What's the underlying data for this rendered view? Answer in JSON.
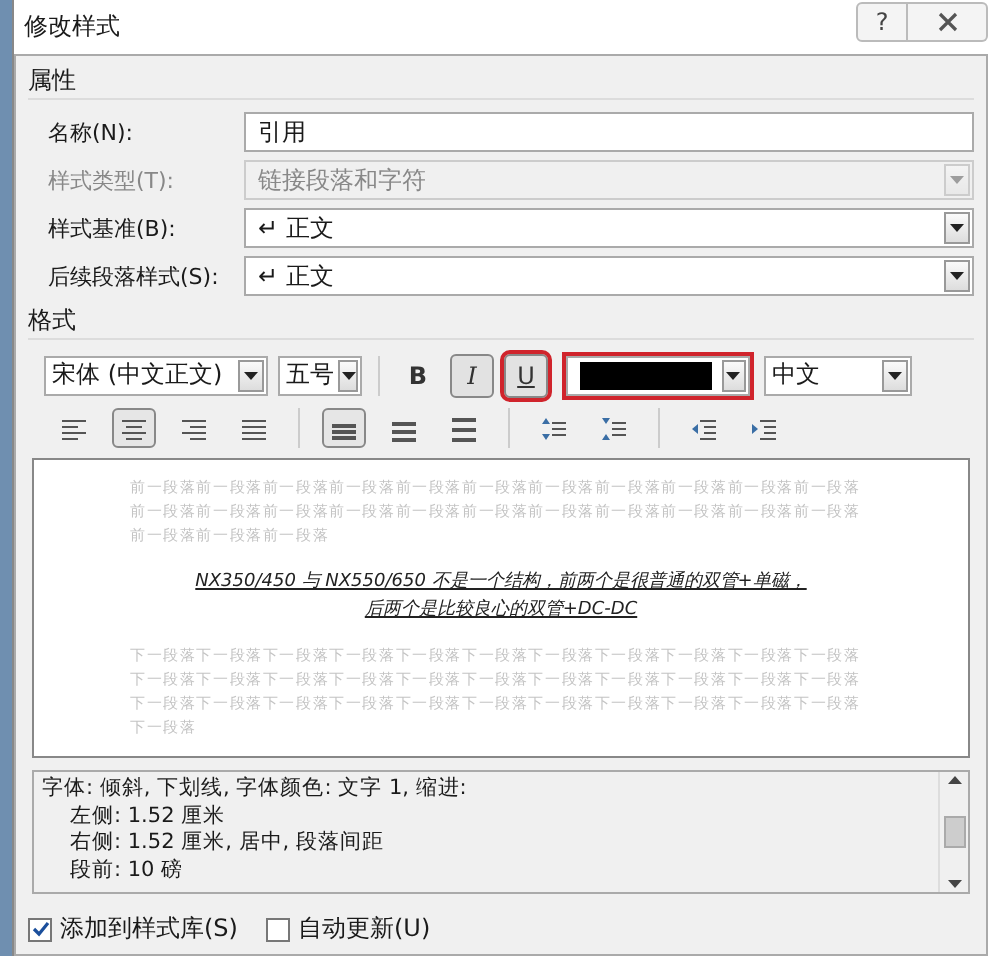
{
  "window": {
    "title": "修改样式",
    "help_button": "?"
  },
  "properties": {
    "heading": "属性",
    "rows": [
      {
        "label": "名称(N):",
        "kind": "text",
        "value": "引用",
        "disabled": false
      },
      {
        "label": "样式类型(T):",
        "kind": "select",
        "value": "链接段落和字符",
        "disabled": true
      },
      {
        "label": "样式基准(B):",
        "kind": "select",
        "value": "↵ 正文",
        "disabled": false
      },
      {
        "label": "后续段落样式(S):",
        "kind": "select",
        "value": "↵ 正文",
        "disabled": false
      }
    ]
  },
  "format": {
    "heading": "格式",
    "font_select": {
      "value": "宋体 (中文正文)"
    },
    "size_select": {
      "value": "五号"
    },
    "style_buttons": [
      {
        "label": "B",
        "kind": "bold",
        "selected": false,
        "highlighted": false
      },
      {
        "label": "I",
        "kind": "italic",
        "selected": true,
        "highlighted": false
      },
      {
        "label": "U",
        "kind": "underline",
        "selected": true,
        "highlighted": true
      }
    ],
    "color_select": {
      "color": "#000000",
      "highlighted": true
    },
    "language_select": {
      "value": "中文"
    },
    "paragraph_toolbar": [
      [
        {
          "kind": "align-left",
          "selected": false
        },
        {
          "kind": "align-center",
          "selected": true
        },
        {
          "kind": "align-right",
          "selected": false
        },
        {
          "kind": "justify",
          "selected": false
        }
      ],
      [
        {
          "kind": "spacing-single",
          "selected": true
        },
        {
          "kind": "spacing-one-half",
          "selected": false
        },
        {
          "kind": "spacing-double",
          "selected": false
        }
      ],
      [
        {
          "kind": "space-before",
          "selected": false
        },
        {
          "kind": "space-after",
          "selected": false
        }
      ],
      [
        {
          "kind": "indent-decrease",
          "selected": false
        },
        {
          "kind": "indent-increase",
          "selected": false
        }
      ]
    ]
  },
  "preview": {
    "previous_paragraph": "前一段落前一段落前一段落前一段落前一段落前一段落前一段落前一段落前一段落前一段落前一段落前一段落前一段落前一段落前一段落前一段落前一段落前一段落前一段落前一段落前一段落前一段落前一段落前一段落前一段落",
    "sample": "NX350/450 与 NX550/650 不是一个结构，前两个是很普通的双管+单磁，后两个是比较良心的双管+DC-DC",
    "next_paragraph": "下一段落下一段落下一段落下一段落下一段落下一段落下一段落下一段落下一段落下一段落下一段落下一段落下一段落下一段落下一段落下一段落下一段落下一段落下一段落下一段落下一段落下一段落下一段落下一段落下一段落下一段落下一段落下一段落下一段落下一段落下一段落下一段落下一段落下一段落"
  },
  "description": [
    "字体: 倾斜, 下划线, 字体颜色: 文字 1, 缩进:",
    "左侧:  1.52 厘米",
    "右侧:  1.52 厘米, 居中, 段落间距",
    "段前: 10 磅"
  ],
  "options": [
    {
      "label": "添加到样式库(S)",
      "checked": true
    },
    {
      "label": "自动更新(U)",
      "checked": false
    }
  ]
}
